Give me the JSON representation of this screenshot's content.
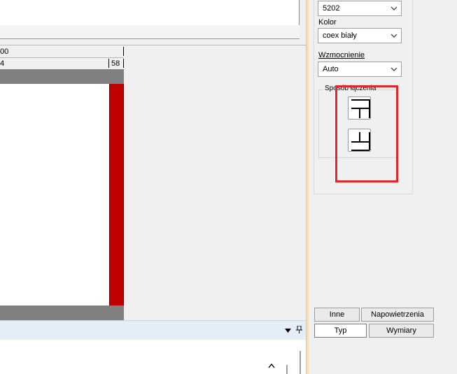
{
  "ruler": {
    "top_value": "00",
    "bottom_left_value": "4",
    "bottom_right_value": "58"
  },
  "right_panel": {
    "profile_combo_value": "5202",
    "kolor_label": "Kolor",
    "kolor_value": "coex biały",
    "wzmocnienie_label": "Wzmocnienie",
    "wzmocnienie_value": "Auto",
    "sposob_label": "Sposób łączenia"
  },
  "buttons": {
    "inne": "Inne",
    "napowietrzenia": "Napowietrzenia",
    "typ": "Typ",
    "wymiary": "Wymiary"
  },
  "colors": {
    "frame_gray": "#808080",
    "frame_red": "#c00000",
    "highlight": "#e3262e",
    "splitter": "#f5deb3"
  }
}
